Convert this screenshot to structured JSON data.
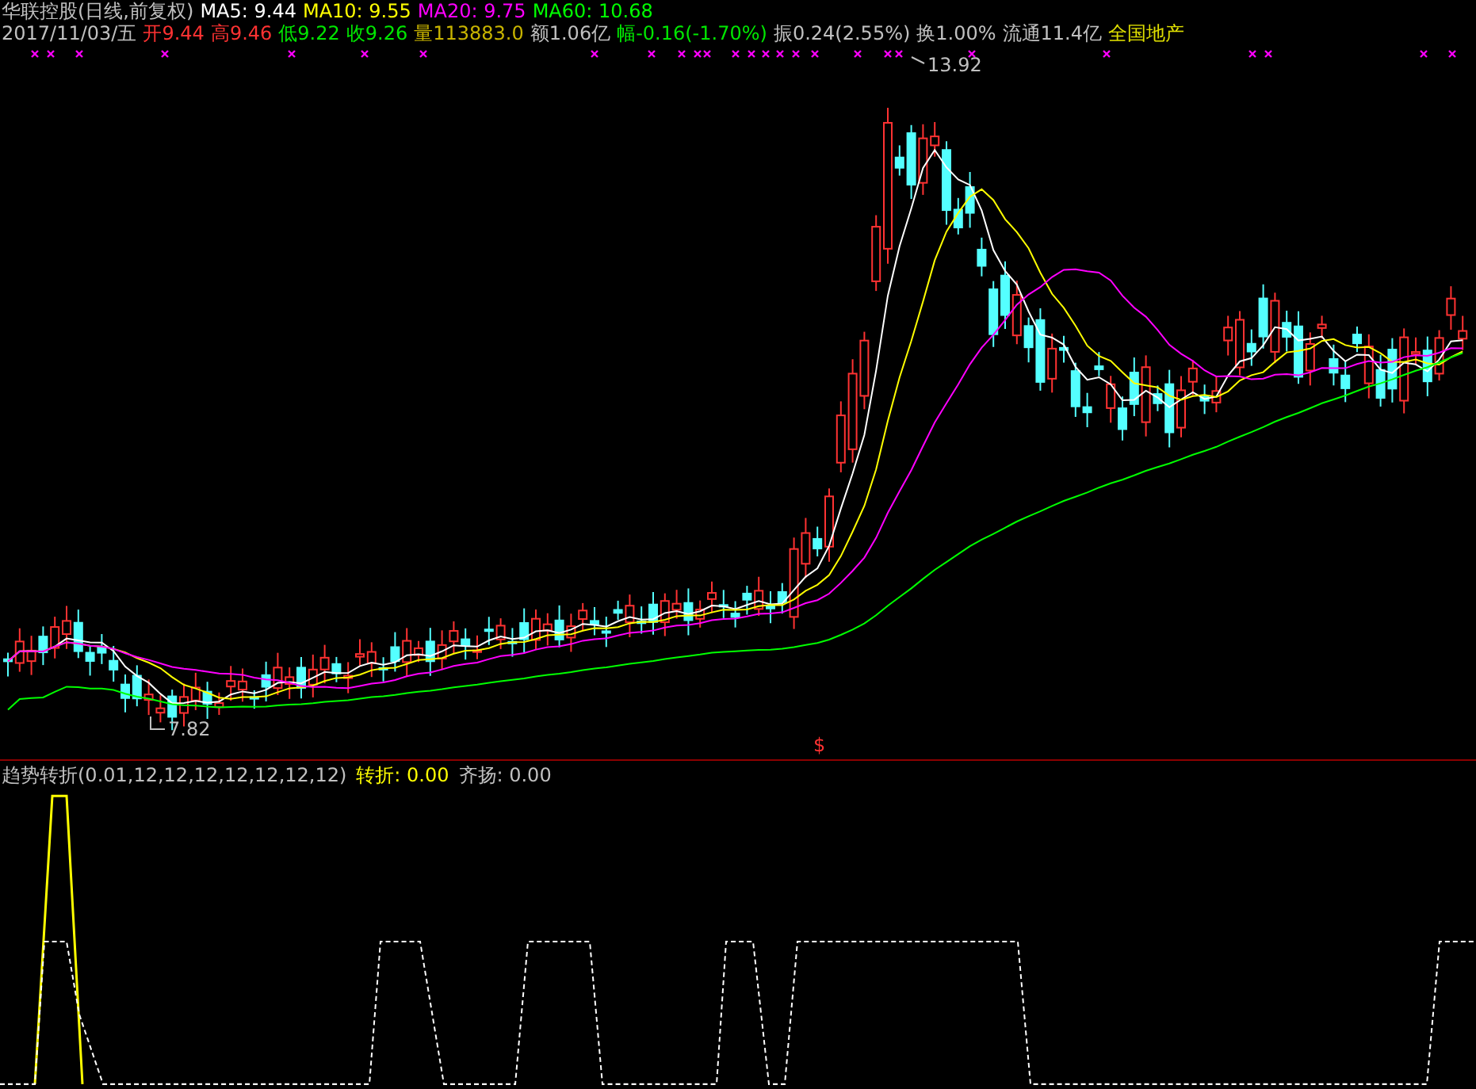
{
  "title": {
    "name": "华联控股(日线,前复权)",
    "ma": [
      {
        "label": "MA5: 9.44",
        "color": "#ffffff"
      },
      {
        "label": "MA10: 9.55",
        "color": "#ffff00"
      },
      {
        "label": "MA20: 9.75",
        "color": "#ff00ff"
      },
      {
        "label": "MA60: 10.68",
        "color": "#00ff00"
      }
    ]
  },
  "quote": [
    {
      "text": "2017/11/03/五",
      "color": "#c0c0c0"
    },
    {
      "text": "开9.44",
      "color": "#ff3232"
    },
    {
      "text": "高9.46",
      "color": "#ff3232"
    },
    {
      "text": "低9.22",
      "color": "#00e600"
    },
    {
      "text": "收9.26",
      "color": "#00e600"
    },
    {
      "text": "量113883.0",
      "color": "#c8b400"
    },
    {
      "text": "额1.06亿",
      "color": "#c0c0c0"
    },
    {
      "text": "幅-0.16(-1.70%)",
      "color": "#00e600"
    },
    {
      "text": "振0.24(2.55%)",
      "color": "#c0c0c0"
    },
    {
      "text": "换1.00%",
      "color": "#c0c0c0"
    },
    {
      "text": "流通11.4亿",
      "color": "#c0c0c0"
    },
    {
      "text": "全国地产",
      "color": "#e0e000"
    }
  ],
  "chart": {
    "high_label": "13.92",
    "low_label": "7.82",
    "signal": "$"
  },
  "indicator": {
    "name": "趋势转折(0.01,12,12,12,12,12,12,12)",
    "values": [
      {
        "text": "转折: 0.00",
        "color": "#ffff00"
      },
      {
        "text": "齐扬: 0.00",
        "color": "#c0c0c0"
      }
    ]
  }
}
